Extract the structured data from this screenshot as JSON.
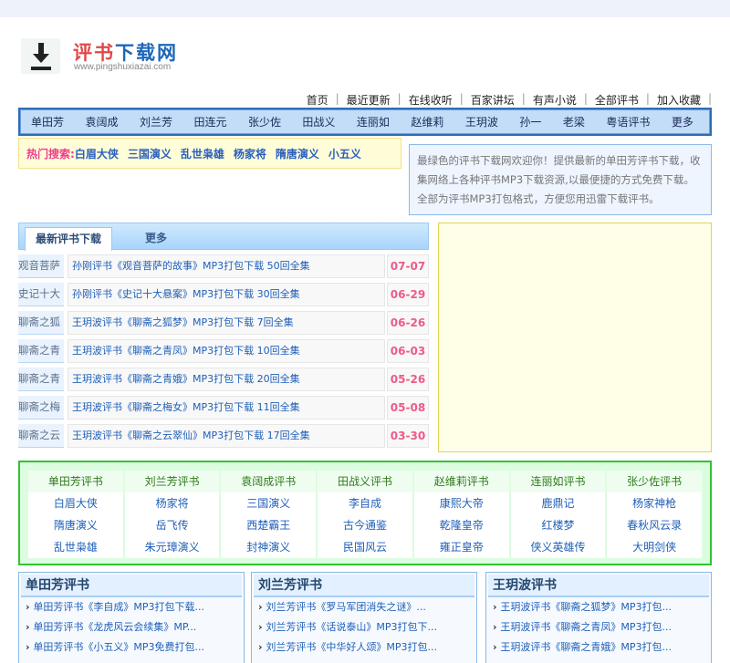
{
  "logo": {
    "title_red": "评书",
    "title_blue": "下载网",
    "url": "www.pingshuxiazai.com"
  },
  "toplinks": [
    "首页",
    "最近更新",
    "在线收听",
    "百家讲坛",
    "有声小说",
    "全部评书",
    "加入收藏"
  ],
  "nav": [
    "单田芳",
    "袁阔成",
    "刘兰芳",
    "田连元",
    "张少佐",
    "田战义",
    "连丽如",
    "赵维莉",
    "王玥波",
    "孙一",
    "老梁",
    "粤语评书",
    "更多"
  ],
  "hot": {
    "label": "热门搜索:",
    "items": [
      "白眉大侠",
      "三国演义",
      "乱世枭雄",
      "杨家将",
      "隋唐演义",
      "小五义"
    ]
  },
  "intro": "最绿色的评书下载网欢迎你！提供最新的单田芳评书下载，收集网络上各种评书MP3下载资源,以最便捷的方式免费下载。全部为评书MP3打包格式，方便您用迅雷下载评书。",
  "latest": {
    "tab": "最新评书下载",
    "more": "更多",
    "rows": [
      {
        "tag": "观音菩萨",
        "title": "孙刚评书《观音菩萨的故事》MP3打包下载  50回全集",
        "date": "07-07"
      },
      {
        "tag": "史记十大",
        "title": "孙刚评书《史记十大悬案》MP3打包下载  30回全集",
        "date": "06-29"
      },
      {
        "tag": "聊斋之狐",
        "title": "王玥波评书《聊斋之狐梦》MP3打包下载  7回全集",
        "date": "06-26"
      },
      {
        "tag": "聊斋之青",
        "title": "王玥波评书《聊斋之青凤》MP3打包下载  10回全集",
        "date": "06-03"
      },
      {
        "tag": "聊斋之青",
        "title": "王玥波评书《聊斋之青娥》MP3打包下载  20回全集",
        "date": "05-26"
      },
      {
        "tag": "聊斋之梅",
        "title": "王玥波评书《聊斋之梅女》MP3打包下载  11回全集",
        "date": "05-08"
      },
      {
        "tag": "聊斋之云",
        "title": "王玥波评书《聊斋之云翠仙》MP3打包下载  17回全集",
        "date": "03-30"
      }
    ]
  },
  "categories": [
    {
      "head": "单田芳评书",
      "items": [
        "白眉大侠",
        "隋唐演义",
        "乱世枭雄"
      ]
    },
    {
      "head": "刘兰芳评书",
      "items": [
        "杨家将",
        "岳飞传",
        "朱元璋演义"
      ]
    },
    {
      "head": "袁阔成评书",
      "items": [
        "三国演义",
        "西楚霸王",
        "封神演义"
      ]
    },
    {
      "head": "田战义评书",
      "items": [
        "李自成",
        "古今通鉴",
        "民国风云"
      ]
    },
    {
      "head": "赵维莉评书",
      "items": [
        "康熙大帝",
        "乾隆皇帝",
        "雍正皇帝"
      ]
    },
    {
      "head": "连丽如评书",
      "items": [
        "鹿鼎记",
        "红楼梦",
        "侠义英雄传"
      ]
    },
    {
      "head": "张少佐评书",
      "items": [
        "杨家神枪",
        "春秋风云录",
        "大明剑侠"
      ]
    }
  ],
  "boxes": [
    {
      "head": "单田芳评书",
      "items": [
        "单田芳评书《李自成》MP3打包下载...",
        "单田芳评书《龙虎风云会续集》MP...",
        "单田芳评书《小五义》MP3免费打包..."
      ]
    },
    {
      "head": "刘兰芳评书",
      "items": [
        "刘兰芳评书《罗马军团消失之谜》...",
        "刘兰芳评书《话说泰山》MP3打包下...",
        "刘兰芳评书《中华好人颂》MP3打包..."
      ]
    },
    {
      "head": "王玥波评书",
      "items": [
        "王玥波评书《聊斋之狐梦》MP3打包...",
        "王玥波评书《聊斋之青凤》MP3打包...",
        "王玥波评书《聊斋之青娥》MP3打包..."
      ]
    }
  ]
}
